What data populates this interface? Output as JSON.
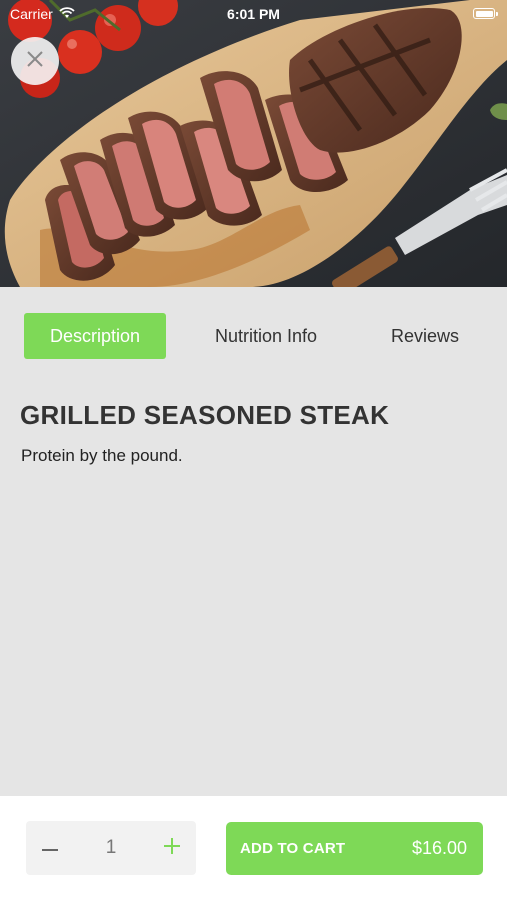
{
  "status_bar": {
    "carrier": "Carrier",
    "time": "6:01 PM"
  },
  "tabs": [
    {
      "label": "Description",
      "active": true
    },
    {
      "label": "Nutrition Info",
      "active": false
    },
    {
      "label": "Reviews",
      "active": false
    }
  ],
  "product": {
    "title": "GRILLED SEASONED STEAK",
    "description": "Protein by the pound."
  },
  "cart": {
    "quantity": "1",
    "add_label": "ADD TO CART",
    "price": "$16.00"
  },
  "colors": {
    "accent": "#7ed957",
    "background": "#e5e5e5",
    "bottom_bar": "#ffffff"
  },
  "icons": {
    "close": "close-icon",
    "minus": "minus-icon",
    "plus": "plus-icon",
    "wifi": "wifi-icon",
    "battery": "battery-icon"
  }
}
